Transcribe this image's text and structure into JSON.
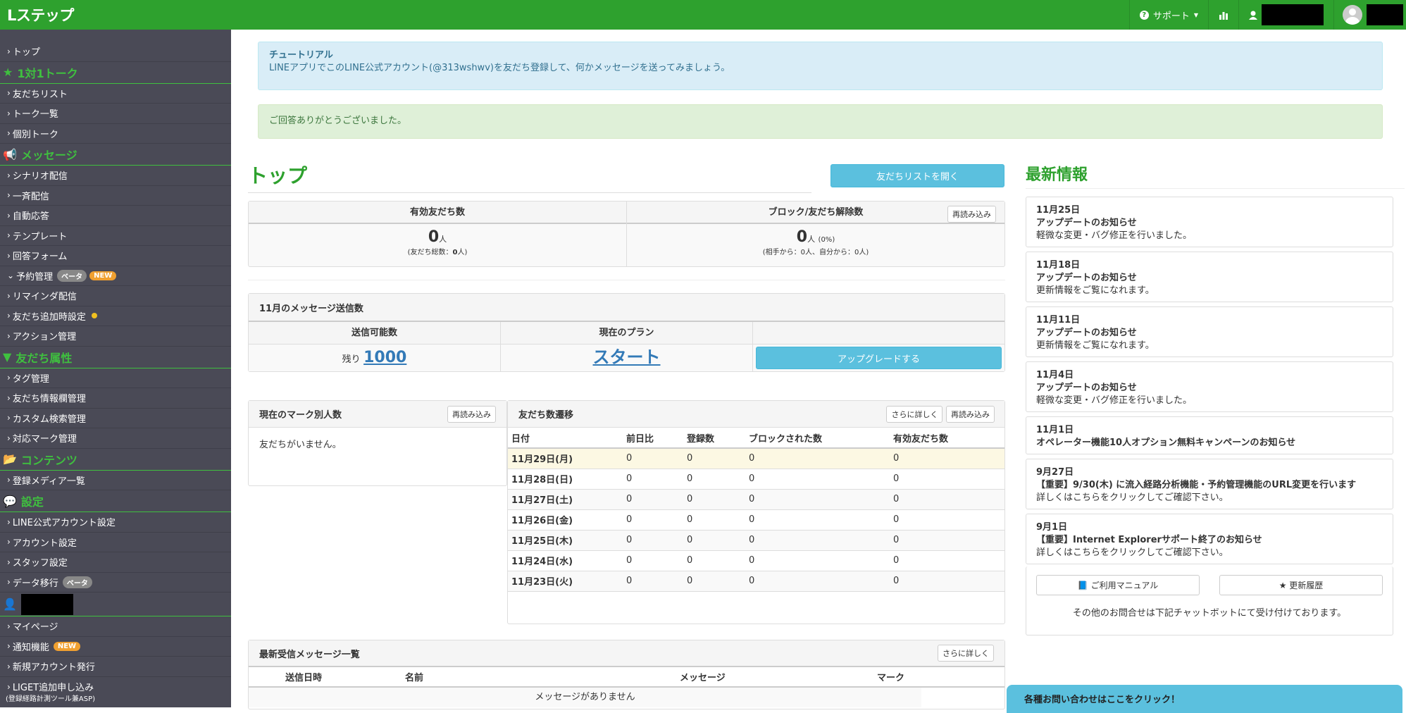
{
  "brand": "Lステップ",
  "topbar": {
    "support": "サポート"
  },
  "sidebar": {
    "top": "トップ",
    "sec1": "1対1トーク",
    "s1": [
      "友だちリスト",
      "トーク一覧",
      "個別トーク"
    ],
    "sec2": "メッセージ",
    "s2": [
      "シナリオ配信",
      "一斉配信",
      "自動応答",
      "テンプレート",
      "回答フォーム"
    ],
    "yoyaku": "予約管理",
    "beta": "ベータ",
    "new": "NEW",
    "s2b": [
      "リマインダ配信",
      "友だち追加時設定",
      "アクション管理"
    ],
    "sec3": "友だち属性",
    "s3": [
      "タグ管理",
      "友だち情報欄管理",
      "カスタム検索管理",
      "対応マーク管理"
    ],
    "sec4": "コンテンツ",
    "s4": [
      "登録メディア一覧"
    ],
    "sec5": "設定",
    "s5": [
      "LINE公式アカウント設定",
      "アカウント設定",
      "スタッフ設定"
    ],
    "migrate": "データ移行",
    "s6": [
      "マイページ"
    ],
    "notify": "通知機能",
    "s7": [
      "新規アカウント発行",
      "LIGET追加申し込み"
    ],
    "liget_sub": "(登録経路計測ツール兼ASP)"
  },
  "alerts": {
    "info_title": "チュートリアル",
    "info_body": "LINEアプリでこのLINE公式アカウント(@313wshwv)を友だち登録して、何かメッセージを送ってみましょう。",
    "success": "ご回答ありがとうございました。"
  },
  "page_title": "トップ",
  "open_friends_btn": "友だちリストを開く",
  "stats": {
    "valid_label": "有効友だち数",
    "valid_value": "0",
    "unit": "人",
    "valid_sub_a": "(友だち総数：",
    "valid_sub_b": "0",
    "valid_sub_c": "人)",
    "block_label": "ブロック/友だち解除数",
    "block_value": "0",
    "block_pct": "(0%)",
    "block_sub": "(相手から：0人、自分から：0人)",
    "reload": "再読み込み"
  },
  "msg": {
    "title": "11月のメッセージ送信数",
    "col1": "送信可能数",
    "col2": "現在のプラン",
    "remain": "残り",
    "remain_value": "1000",
    "plan": "スタート",
    "upgrade": "アップグレードする"
  },
  "marks": {
    "title": "現在のマーク別人数",
    "reload": "再読み込み",
    "empty": "友だちがいません。"
  },
  "trend": {
    "title": "友だち数遷移",
    "more": "さらに詳しく",
    "reload": "再読み込み",
    "headers": [
      "日付",
      "前日比",
      "登録数",
      "ブロックされた数",
      "有効友だち数"
    ],
    "rows": [
      [
        "11月29日(月)",
        "0",
        "0",
        "0",
        "0"
      ],
      [
        "11月28日(日)",
        "0",
        "0",
        "0",
        "0"
      ],
      [
        "11月27日(土)",
        "0",
        "0",
        "0",
        "0"
      ],
      [
        "11月26日(金)",
        "0",
        "0",
        "0",
        "0"
      ],
      [
        "11月25日(木)",
        "0",
        "0",
        "0",
        "0"
      ],
      [
        "11月24日(水)",
        "0",
        "0",
        "0",
        "0"
      ],
      [
        "11月23日(火)",
        "0",
        "0",
        "0",
        "0"
      ]
    ]
  },
  "recent": {
    "title": "最新受信メッセージ一覧",
    "more": "さらに詳しく",
    "headers": [
      "送信日時",
      "名前",
      "メッセージ",
      "マーク"
    ],
    "empty": "メッセージがありません"
  },
  "news": {
    "title": "最新情報",
    "items": [
      {
        "date": "11月25日",
        "title": "アップデートのお知らせ",
        "body": "軽微な変更・バグ修正を行いました。"
      },
      {
        "date": "11月18日",
        "title": "アップデートのお知らせ",
        "body": "更新情報をご覧になれます。"
      },
      {
        "date": "11月11日",
        "title": "アップデートのお知らせ",
        "body": "更新情報をご覧になれます。"
      },
      {
        "date": "11月4日",
        "title": "アップデートのお知らせ",
        "body": "軽微な変更・バグ修正を行いました。"
      },
      {
        "date": "11月1日",
        "title": "オペレーター機能10人オプション無料キャンペーンのお知らせ",
        "body": ""
      },
      {
        "date": "9月27日",
        "title": "【重要】9/30(木) に流入経路分析機能・予約管理機能のURL変更を行います",
        "body": "詳しくはこちらをクリックしてご確認下さい。"
      },
      {
        "date": "9月1日",
        "title": "【重要】Internet Explorerサポート終了のお知らせ",
        "body": "詳しくはこちらをクリックしてご確認下さい。"
      }
    ],
    "manual": "ご利用マニュアル",
    "history": "更新履歴",
    "contact_note": "その他のお問合せは下記チャットボットにて受け付けております。"
  },
  "chat_tab": "各種お問い合わせはここをクリック！"
}
